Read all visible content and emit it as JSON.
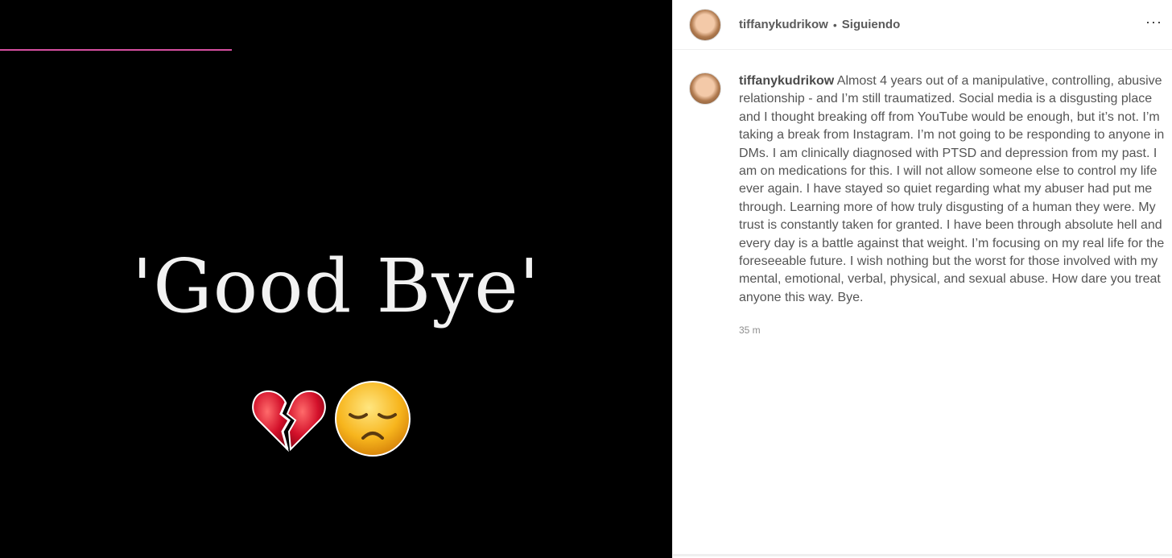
{
  "media": {
    "title_text": "'Good Bye'",
    "emojis": [
      "broken-heart-icon",
      "disappointed-face-icon"
    ],
    "progress_color": "#d64fa0",
    "background": "#000000"
  },
  "header": {
    "username": "tiffanykudrikow",
    "separator": "•",
    "follow_status": "Siguiendo",
    "more_label": "···"
  },
  "caption": {
    "username": "tiffanykudrikow",
    "text": "Almost 4 years out of a manipulative, controlling, abusive relationship - and I’m still traumatized. Social media is a disgusting place and I thought breaking off from YouTube would be enough, but it’s not. I’m taking a break from Instagram. I’m not going to be responding to anyone in DMs. I am clinically diagnosed with PTSD and depression from my past. I am on medications for this. I will not allow someone else to control my life ever again. I have stayed so quiet regarding what my abuser had put me through. Learning more of how truly disgusting of a human they were. My trust is constantly taken for granted. I have been through absolute hell and every day is a battle against that weight. I’m focusing on my real life for the foreseeable future. I wish nothing but the worst for those involved with my mental, emotional, verbal, physical, and sexual abuse. How dare you treat anyone this way. Bye.",
    "timestamp": "35 m"
  }
}
